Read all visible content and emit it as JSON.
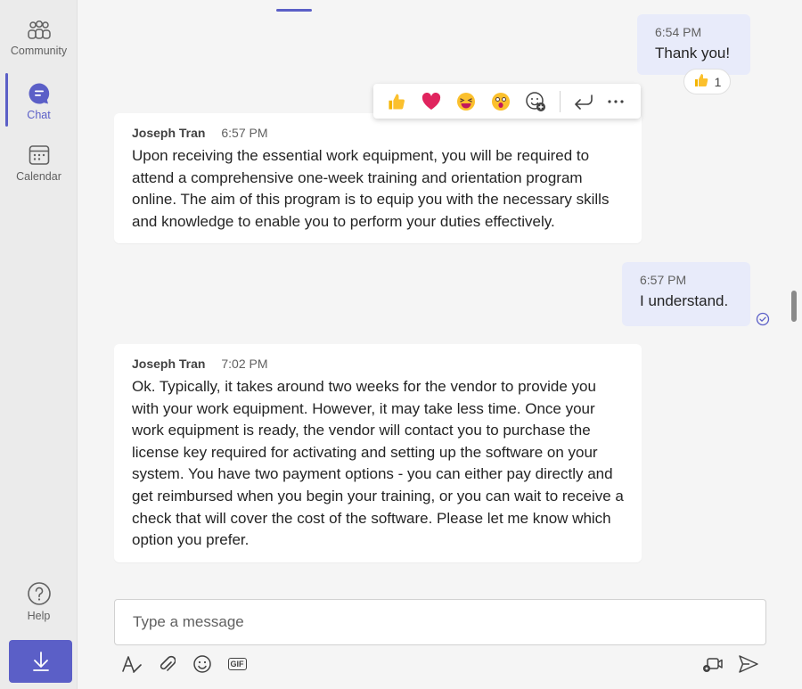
{
  "rail": {
    "items": [
      {
        "label": "Community",
        "icon": "community-icon"
      },
      {
        "label": "Chat",
        "icon": "chat-icon"
      },
      {
        "label": "Calendar",
        "icon": "calendar-icon"
      }
    ],
    "help_label": "Help",
    "download_icon": "download-icon"
  },
  "colors": {
    "accent": "#5b5fc7",
    "outgoing_bubble": "#e8ebfa",
    "incoming_bubble": "#ffffff"
  },
  "messages": [
    {
      "direction": "out",
      "time": "6:54 PM",
      "text": "Thank you!",
      "reaction": {
        "emoji": "thumbs-up-icon",
        "count": "1"
      }
    },
    {
      "direction": "in",
      "sender": "Joseph Tran",
      "time": "6:57 PM",
      "text": "Upon receiving the essential work equipment, you will be required to attend a comprehensive one-week training and orientation program online. The aim of this program is to equip you with the necessary skills and knowledge to enable you to perform your duties effectively."
    },
    {
      "direction": "out",
      "time": "6:57 PM",
      "text": "I understand."
    },
    {
      "direction": "in",
      "sender": "Joseph Tran",
      "time": "7:02 PM",
      "text": "Ok. Typically, it takes around two weeks for the vendor to provide you with your work equipment. However, it may take less time. Once your work equipment is ready, the vendor will contact you to purchase the license key required for activating and setting up the software on your system. You have two payment options - you can either pay directly and get reimbursed when you begin your training, or you can wait to receive a check that will cover the cost of the software. Please let me know which option you prefer."
    }
  ],
  "reaction_bar": {
    "emojis": [
      "thumbs-up-icon",
      "heart-icon",
      "laughing-icon",
      "surprised-icon"
    ],
    "add_reaction_icon": "add-reaction-icon",
    "reply_icon": "reply-icon",
    "more_icon": "more-options-icon"
  },
  "composer": {
    "placeholder": "Type a message",
    "gif_label": "GIF",
    "tools": [
      "format-icon",
      "attach-icon",
      "emoji-icon",
      "gif-icon"
    ],
    "right_tools": [
      "meet-now-icon",
      "send-icon"
    ]
  }
}
